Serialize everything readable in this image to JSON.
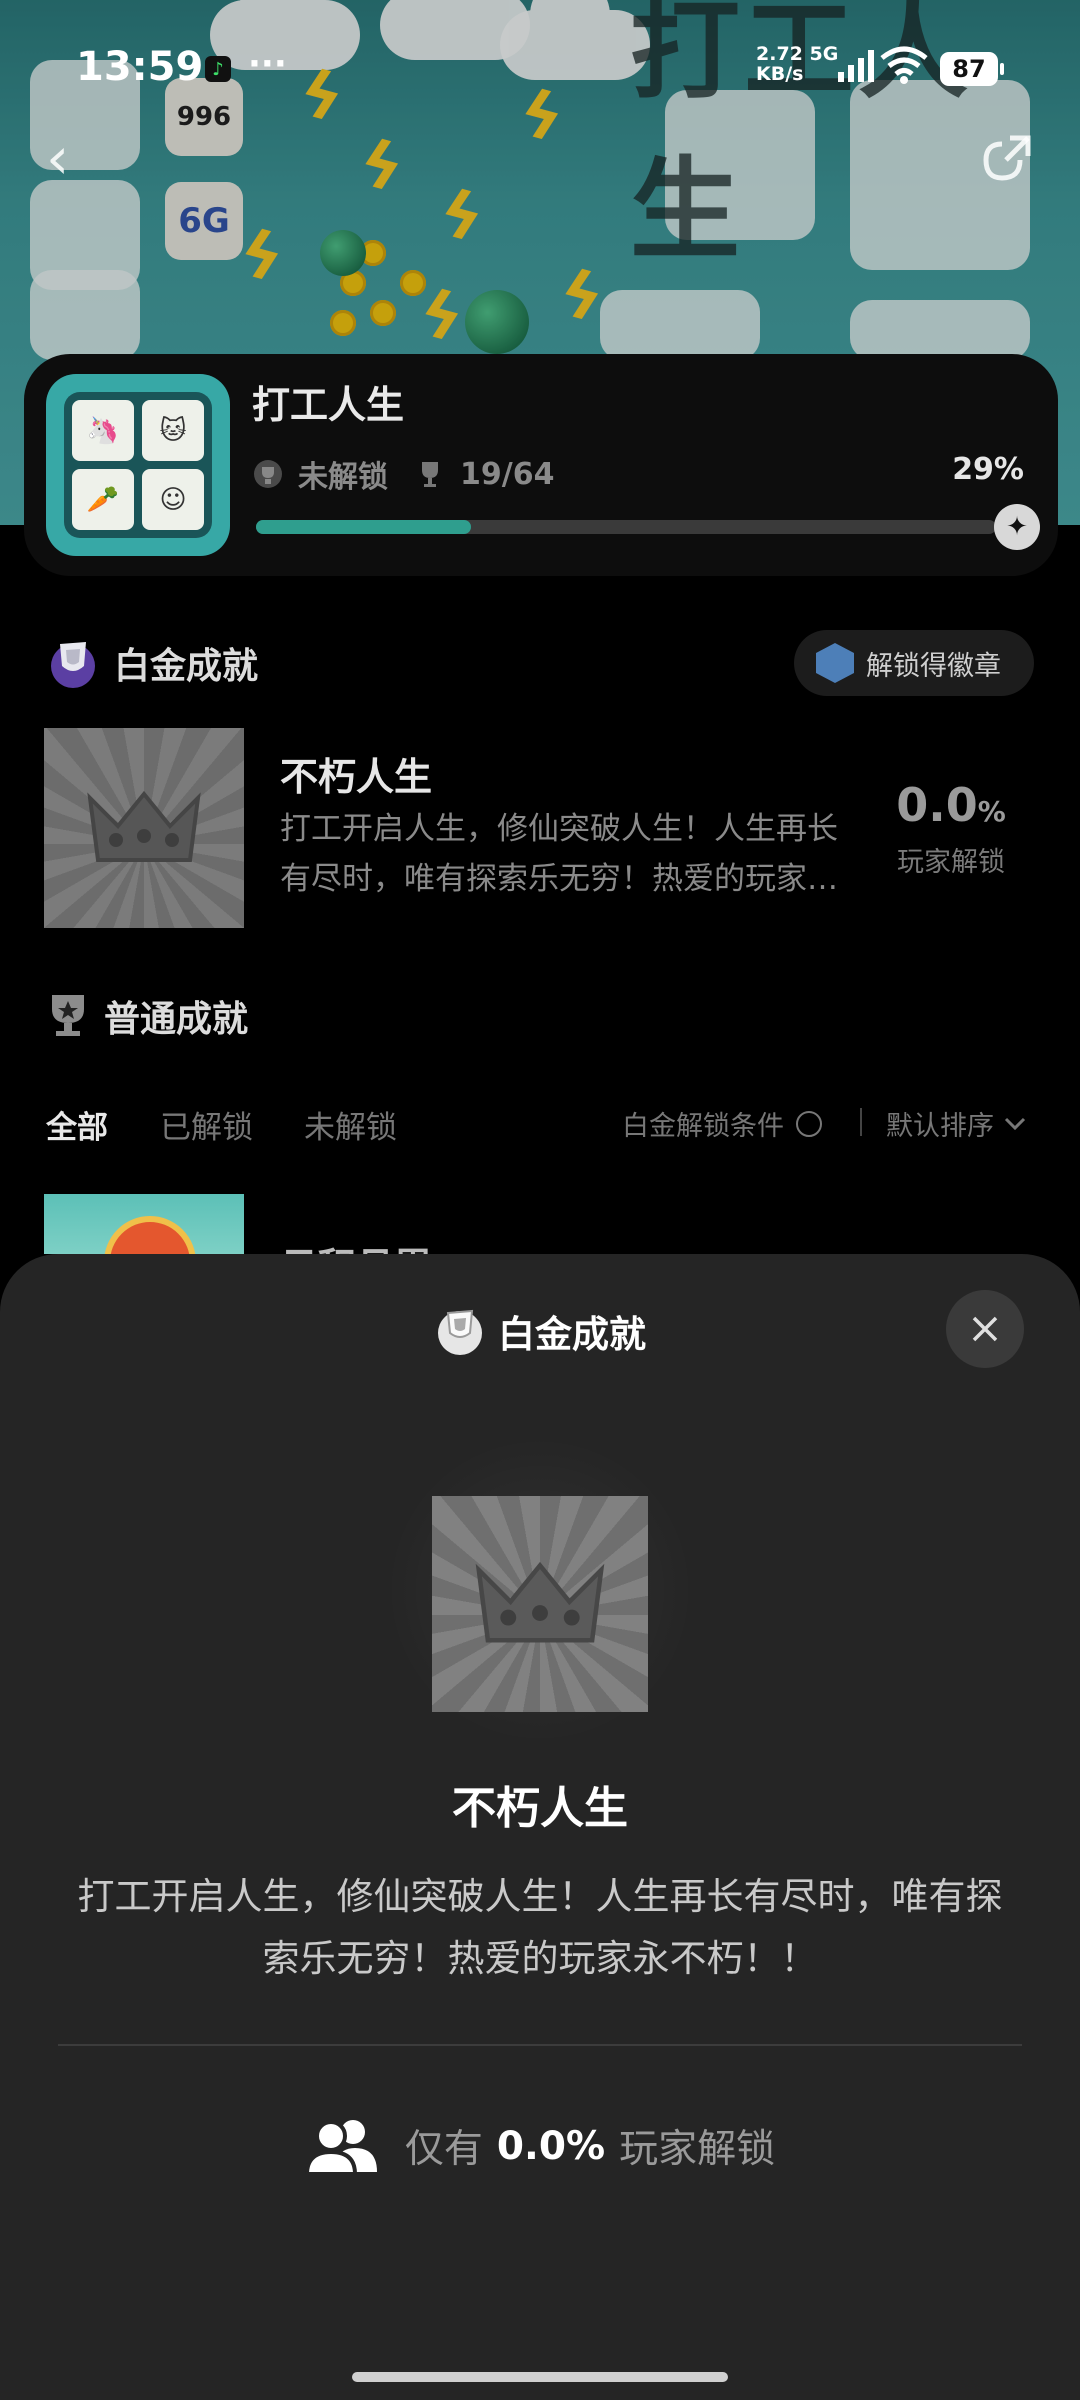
{
  "status_bar": {
    "time": "13:59",
    "more": "···",
    "net_speed_value": "2.72",
    "net_speed_unit": "KB/s",
    "network": "5G",
    "battery": "87"
  },
  "hero": {
    "title_art": "打工人生",
    "tile_texts": [
      "996",
      "6G"
    ]
  },
  "game": {
    "title": "打工人生",
    "status": "未解锁",
    "trophies": "19/64",
    "percent": "29%",
    "progress": 0.29
  },
  "platinum_section": {
    "title": "白金成就",
    "badge_button": "解锁得徽章",
    "achievement": {
      "title": "不朽人生",
      "description": "打工开启人生，修仙突破人生！人生再长有尽时，唯有探索乐无穷！热爱的玩家永不朽！！",
      "percent_value": "0.0",
      "percent_sign": "%",
      "percent_label": "玩家解锁"
    }
  },
  "normal_section": {
    "title": "普通成就",
    "filters": [
      "全部",
      "已解锁",
      "未解锁"
    ],
    "active_filter": "全部",
    "platinum_condition": "白金解锁条件",
    "sort": "默认排序",
    "peek_title": "日积月累"
  },
  "sheet": {
    "header": "白金成就",
    "title": "不朽人生",
    "description": "打工开启人生，修仙突破人生！人生再长有尽时，唯有探索乐无穷！热爱的玩家永不朽！！",
    "unlock_prefix": "仅有",
    "unlock_value": "0.0%",
    "unlock_suffix": "玩家解锁"
  },
  "colors": {
    "accent": "#2f9e8e",
    "sheet_bg": "#252525",
    "page_bg": "#000000"
  }
}
